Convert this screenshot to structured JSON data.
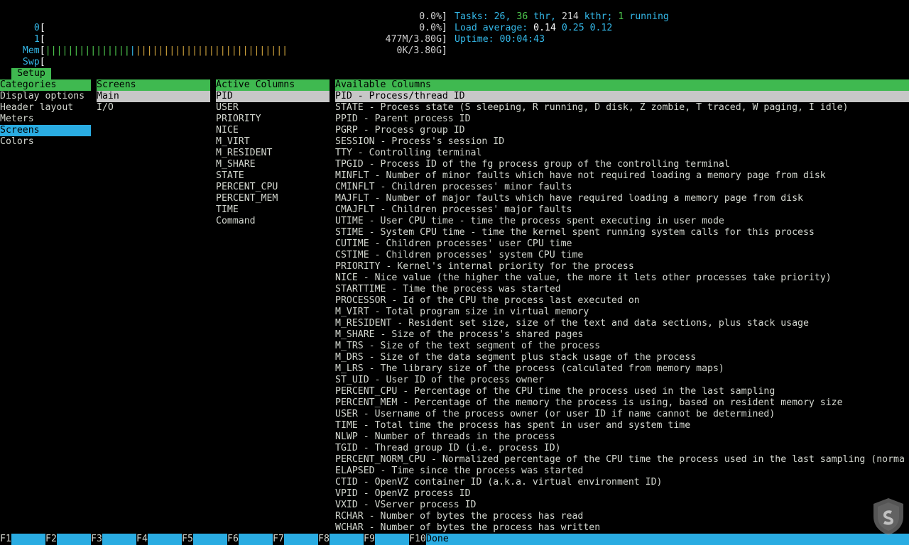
{
  "meters": {
    "cpu0": {
      "label": "0",
      "value": "0.0%"
    },
    "cpu1": {
      "label": "1",
      "value": "0.0%"
    },
    "mem": {
      "label": "Mem",
      "value": "477M/3.80G"
    },
    "swp": {
      "label": "Swp",
      "value": "0K/3.80G"
    }
  },
  "stats": {
    "tasks_label": "Tasks:",
    "tasks": "26",
    "thr": "36",
    "thr_label": "thr,",
    "kthr": "214",
    "kthr_label": "kthr;",
    "running": "1",
    "running_label": "running",
    "load_label": "Load average:",
    "load1": "0.14",
    "load5": "0.25",
    "load15": "0.12",
    "uptime_label": "Uptime:",
    "uptime": "00:04:43"
  },
  "setup_tab": "Setup",
  "categories": {
    "header": "Categories",
    "items": [
      "Display options",
      "Header layout",
      "Meters",
      "Screens",
      "Colors"
    ],
    "selected": "Screens"
  },
  "screens": {
    "header": "Screens",
    "items": [
      "Main",
      "I/O"
    ],
    "selected": "Main"
  },
  "active_columns": {
    "header": "Active Columns",
    "items": [
      "PID",
      "USER",
      "PRIORITY",
      "NICE",
      "M_VIRT",
      "M_RESIDENT",
      "M_SHARE",
      "STATE",
      "PERCENT_CPU",
      "PERCENT_MEM",
      "TIME",
      "Command"
    ],
    "selected": "PID"
  },
  "available_columns": {
    "header": "Available Columns",
    "items": [
      "PID - Process/thread ID",
      "STATE - Process state (S sleeping, R running, D disk, Z zombie, T traced, W paging, I idle)",
      "PPID - Parent process ID",
      "PGRP - Process group ID",
      "SESSION - Process's session ID",
      "TTY - Controlling terminal",
      "TPGID - Process ID of the fg process group of the controlling terminal",
      "MINFLT - Number of minor faults which have not required loading a memory page from disk",
      "CMINFLT - Children processes' minor faults",
      "MAJFLT - Number of major faults which have required loading a memory page from disk",
      "CMAJFLT - Children processes' major faults",
      "UTIME - User CPU time - time the process spent executing in user mode",
      "STIME - System CPU time - time the kernel spent running system calls for this process",
      "CUTIME - Children processes' user CPU time",
      "CSTIME - Children processes' system CPU time",
      "PRIORITY - Kernel's internal priority for the process",
      "NICE - Nice value (the higher the value, the more it lets other processes take priority)",
      "STARTTIME - Time the process was started",
      "PROCESSOR - Id of the CPU the process last executed on",
      "M_VIRT - Total program size in virtual memory",
      "M_RESIDENT - Resident set size, size of the text and data sections, plus stack usage",
      "M_SHARE - Size of the process's shared pages",
      "M_TRS - Size of the text segment of the process",
      "M_DRS - Size of the data segment plus stack usage of the process",
      "M_LRS - The library size of the process (calculated from memory maps)",
      "ST_UID - User ID of the process owner",
      "PERCENT_CPU - Percentage of the CPU time the process used in the last sampling",
      "PERCENT_MEM - Percentage of the memory the process is using, based on resident memory size",
      "USER - Username of the process owner (or user ID if name cannot be determined)",
      "TIME - Total time the process has spent in user and system time",
      "NLWP - Number of threads in the process",
      "TGID - Thread group ID (i.e. process ID)",
      "PERCENT_NORM_CPU - Normalized percentage of the CPU time the process used in the last sampling (norma",
      "ELAPSED - Time since the process was started",
      "CTID - OpenVZ container ID (a.k.a. virtual environment ID)",
      "VPID - OpenVZ process ID",
      "VXID - VServer process ID",
      "RCHAR - Number of bytes the process has read",
      "WCHAR - Number of bytes the process has written"
    ],
    "selected": "PID - Process/thread ID"
  },
  "function_keys": [
    {
      "key": "F1",
      "label": ""
    },
    {
      "key": "F2",
      "label": ""
    },
    {
      "key": "F3",
      "label": ""
    },
    {
      "key": "F4",
      "label": ""
    },
    {
      "key": "F5",
      "label": ""
    },
    {
      "key": "F6",
      "label": ""
    },
    {
      "key": "F7",
      "label": ""
    },
    {
      "key": "F8",
      "label": ""
    },
    {
      "key": "F9",
      "label": ""
    },
    {
      "key": "F10",
      "label": "Done"
    }
  ],
  "colors": {
    "header_green": "#3fb950",
    "selection_blue": "#2aace2",
    "selection_gray": "#c7c7c7",
    "label_cyan": "#34b8e8"
  }
}
